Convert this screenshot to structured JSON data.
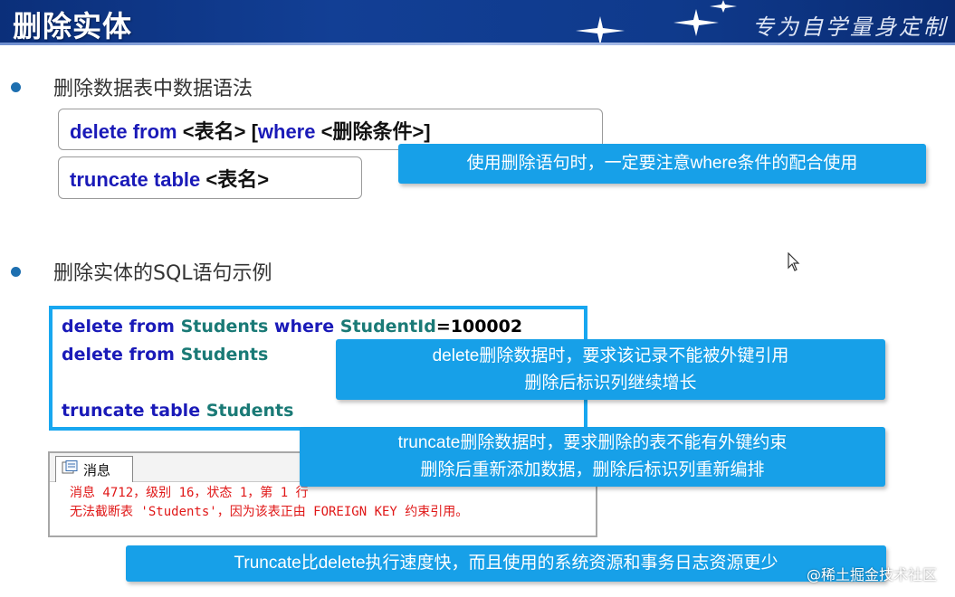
{
  "header": {
    "title": "删除实体",
    "slogan": "专为自学量身定制"
  },
  "bullets": {
    "syntax_heading": "删除数据表中数据语法",
    "example_heading": "删除实体的SQL语句示例"
  },
  "syntax": {
    "delete_kw1": "delete",
    "delete_kw2": "from",
    "delete_table": "<表名>",
    "delete_open": "[",
    "delete_where": "where",
    "delete_cond": "<删除条件>]",
    "truncate_kw1": "truncate",
    "truncate_kw2": "table",
    "truncate_table": "<表名>"
  },
  "callouts": {
    "where_note": "使用删除语句时，一定要注意where条件的配合使用",
    "delete_note_line1": "delete删除数据时，要求该记录不能被外键引用",
    "delete_note_line2": "删除后标识列继续增长",
    "truncate_note_line1": "truncate删除数据时，要求删除的表不能有外键约束",
    "truncate_note_line2": "删除后重新添加数据，删除后标识列重新编排",
    "speed_note": "Truncate比delete执行速度快，而且使用的系统资源和事务日志资源更少"
  },
  "code": {
    "line1_kw": "delete from",
    "line1_tbl": "Students",
    "line1_where": "where",
    "line1_col": "StudentId",
    "line1_eq": "=",
    "line1_val": "100002",
    "line2_kw": "delete from",
    "line2_tbl": "Students",
    "line3_kw": "truncate table",
    "line3_tbl": "Students"
  },
  "messages": {
    "tab_label": "消息",
    "line1": "消息 4712，级别 16，状态 1，第 1 行",
    "line2": "无法截断表 'Students'，因为该表正由 FOREIGN KEY 约束引用。"
  },
  "watermark": "@稀土掘金技术社区",
  "colors": {
    "accent_blue": "#17a0e8",
    "keyword_blue": "#1a1ab8",
    "table_teal": "#1a7a76",
    "error_red": "#e01818",
    "header_navy": "#0f3a8c"
  }
}
